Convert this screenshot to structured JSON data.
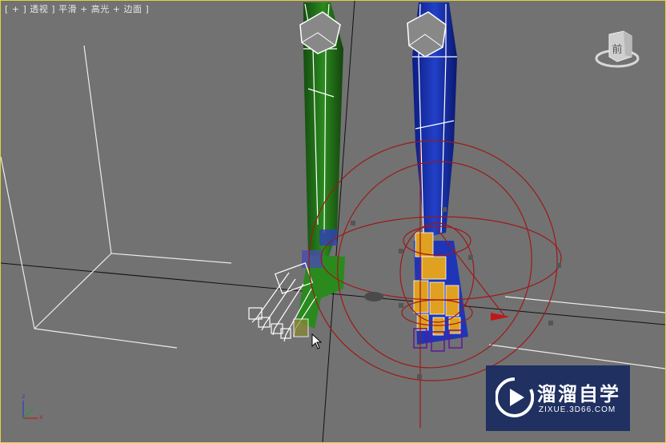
{
  "viewport": {
    "label": "[ + ] 透视 ] 平滑 + 高光 + 边面 ]",
    "border_color": "#e2d23a",
    "background_color": "#727272"
  },
  "viewcube": {
    "face_label": "前",
    "icon": "viewcube-icon"
  },
  "axis_tripod": {
    "x_label": "x",
    "y_label": "y",
    "z_label": "z"
  },
  "cursor": {
    "icon": "mouse-pointer-icon"
  },
  "watermark": {
    "brand_text": "溜溜自学",
    "site_text": "ZIXUE.3D66.COM",
    "icon": "play-logo-icon",
    "background_color": "#182a60"
  },
  "colors": {
    "left_leg": "#1f6e16",
    "right_leg": "#1530a0",
    "ik_gizmo": "#9c1a1a",
    "foot_bones": "#e0a020",
    "wire_white": "#ffffff"
  }
}
